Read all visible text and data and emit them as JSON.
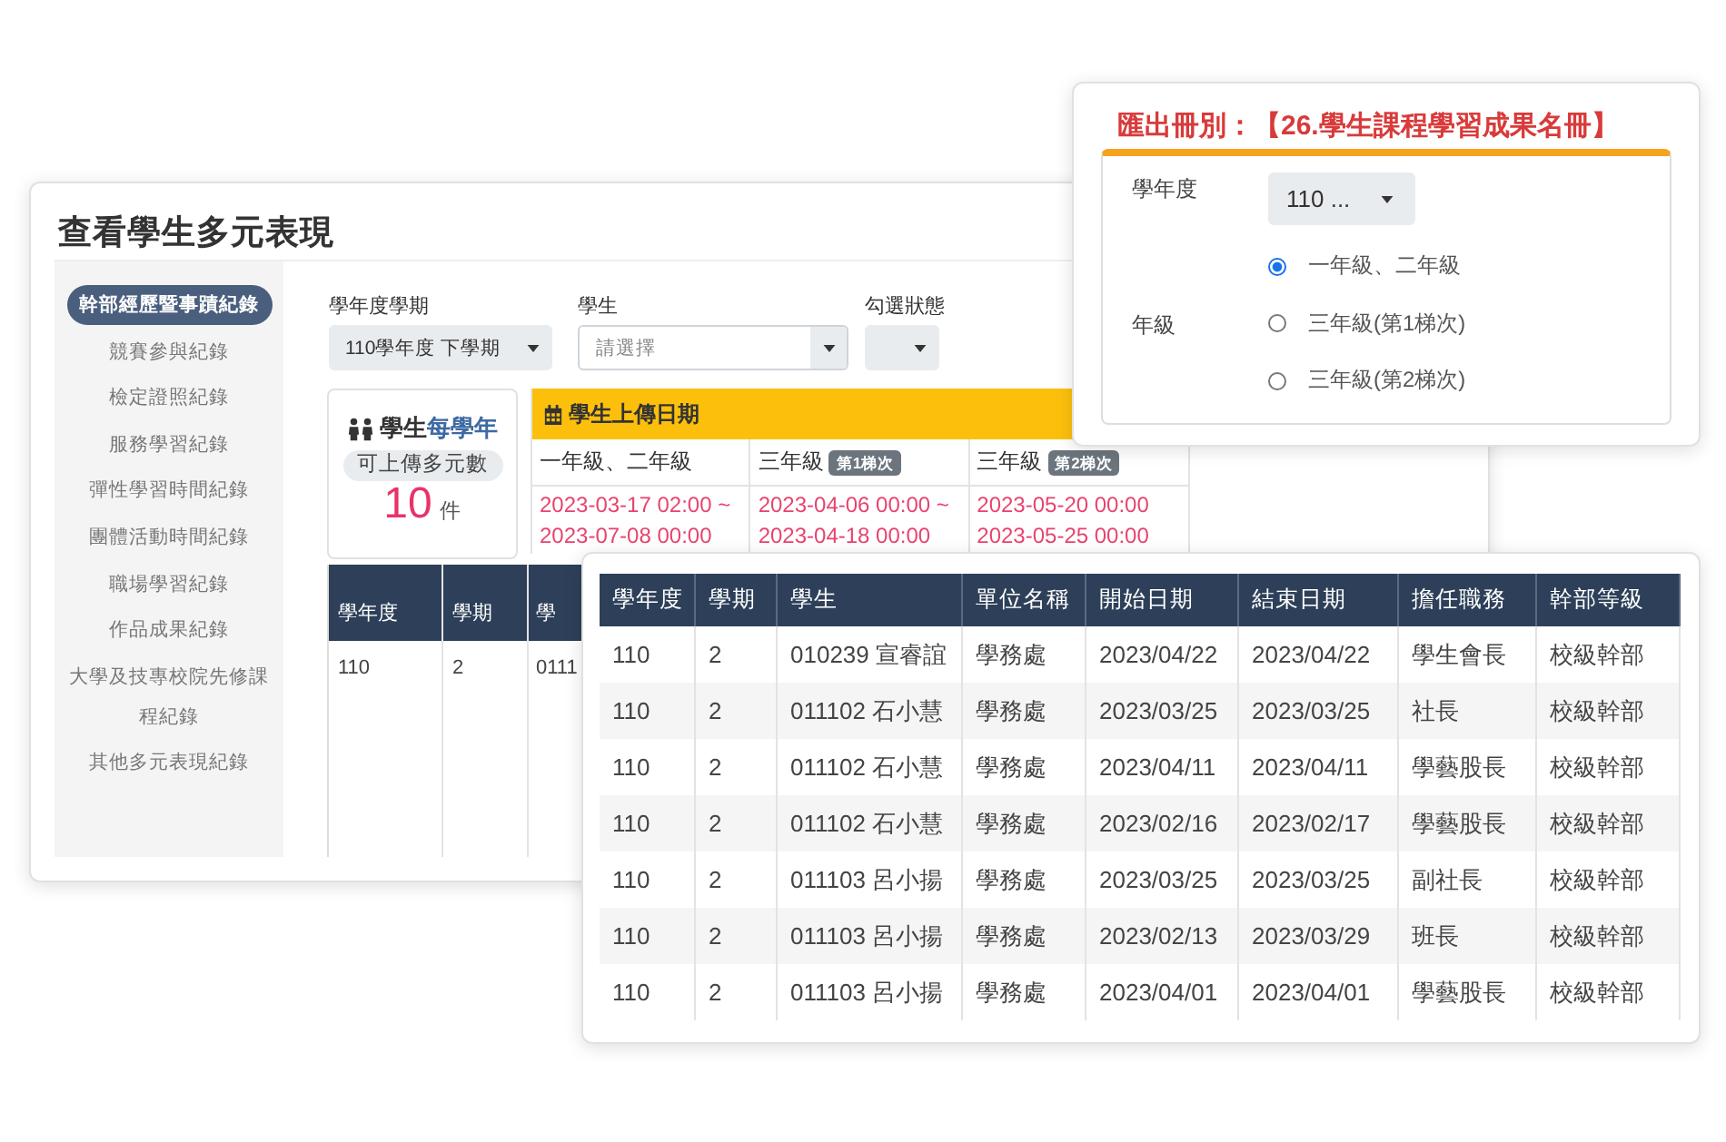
{
  "main_window": {
    "title": "查看學生多元表現",
    "sidebar": {
      "items": [
        {
          "label": "幹部經歷暨事蹟紀錄",
          "selected": true
        },
        {
          "label": "競賽參與紀錄",
          "selected": false
        },
        {
          "label": "檢定證照紀錄",
          "selected": false
        },
        {
          "label": "服務學習紀錄",
          "selected": false
        },
        {
          "label": "彈性學習時間紀錄",
          "selected": false
        },
        {
          "label": "團體活動時間紀錄",
          "selected": false
        },
        {
          "label": "職場學習紀錄",
          "selected": false
        },
        {
          "label": "作品成果紀錄",
          "selected": false
        },
        {
          "label": "大學及技專校院先修課程紀錄",
          "selected": false
        },
        {
          "label": "其他多元表現紀錄",
          "selected": false
        }
      ]
    },
    "filters": [
      {
        "kind": "select",
        "label": "學年度學期",
        "value": "110學年度 下學期"
      },
      {
        "kind": "search-select",
        "label": "學生",
        "placeholder": "請選擇"
      },
      {
        "kind": "select",
        "label": "勾選狀態"
      }
    ],
    "quota_card": {
      "title": "學生",
      "title_emphasis": "每學年",
      "caption": "可上傳多元數",
      "count": "10",
      "unit": "件"
    },
    "upload_dates": {
      "title": "學生上傳日期",
      "columns": [
        {
          "grade": "一年級、二年級",
          "start": "2023-03-17 02:00 ~",
          "end": "2023-07-08 00:00"
        },
        {
          "grade": "三年級",
          "badge": "第1梯次",
          "start": "2023-04-06 00:00 ~",
          "end": "2023-04-18 00:00"
        },
        {
          "grade": "三年級",
          "badge": "第2梯次",
          "start": "2023-05-20 00:00",
          "end": "2023-05-25 00:00"
        }
      ]
    },
    "records_table": {
      "columns": [
        "學年度",
        "學期",
        "學"
      ],
      "rows": [
        [
          "110",
          "2",
          "0111"
        ]
      ]
    }
  },
  "export_dialog": {
    "title": "匯出冊別：【26.學生課程學習成果名冊】",
    "year": {
      "label": "學年度",
      "value": "110 ..."
    },
    "grade": {
      "label": "年級",
      "options": [
        {
          "label": "一年級、二年級",
          "selected": true
        },
        {
          "label": "三年級(第1梯次)",
          "selected": false
        },
        {
          "label": "三年級(第2梯次)",
          "selected": false
        }
      ]
    }
  },
  "records_popup": {
    "columns": [
      "學年度",
      "學期",
      "學生",
      "單位名稱",
      "開始日期",
      "結束日期",
      "擔任職務",
      "幹部等級"
    ],
    "rows": [
      [
        "110",
        "2",
        "010239 宣睿誼",
        "學務處",
        "2023/04/22",
        "2023/04/22",
        "學生會長",
        "校級幹部"
      ],
      [
        "110",
        "2",
        "011102 石小慧",
        "學務處",
        "2023/03/25",
        "2023/03/25",
        "社長",
        "校級幹部"
      ],
      [
        "110",
        "2",
        "011102 石小慧",
        "學務處",
        "2023/04/11",
        "2023/04/11",
        "學藝股長",
        "校級幹部"
      ],
      [
        "110",
        "2",
        "011102 石小慧",
        "學務處",
        "2023/02/16",
        "2023/02/17",
        "學藝股長",
        "校級幹部"
      ],
      [
        "110",
        "2",
        "011103 呂小揚",
        "學務處",
        "2023/03/25",
        "2023/03/25",
        "副社長",
        "校級幹部"
      ],
      [
        "110",
        "2",
        "011103 呂小揚",
        "學務處",
        "2023/02/13",
        "2023/03/29",
        "班長",
        "校級幹部"
      ],
      [
        "110",
        "2",
        "011103 呂小揚",
        "學務處",
        "2023/04/01",
        "2023/04/01",
        "學藝股長",
        "校級幹部"
      ]
    ]
  }
}
